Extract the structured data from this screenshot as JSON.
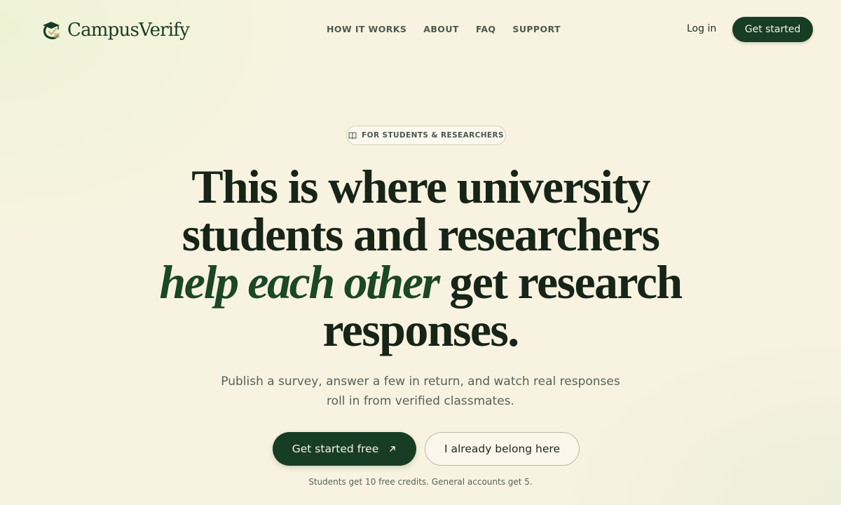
{
  "brand": {
    "name": "CampusVerify",
    "logo_icon": "graduation-cap-check-icon"
  },
  "nav": {
    "links": [
      "HOW IT WORKS",
      "ABOUT",
      "FAQ",
      "SUPPORT"
    ],
    "login": "Log in",
    "cta": "Get started"
  },
  "hero": {
    "badge": {
      "icon": "open-book-icon",
      "label": "FOR STUDENTS & RESEARCHERS"
    },
    "headline": {
      "line1": "This is where university",
      "line2": "students and researchers",
      "line3_italic": "help each other",
      "line3_rest": " get research",
      "line4": "responses."
    },
    "subtext_line1": "Publish a survey, answer a few in return, and watch real responses",
    "subtext_line2": "roll in from verified classmates.",
    "primary_button": "Get started free",
    "primary_icon": "arrow-up-right-icon",
    "secondary_button": "I already belong here",
    "fineprint": "Students get 10 free credits. General accounts get 5."
  },
  "colors": {
    "brand_green": "#173d24",
    "background": "#f8f3e1",
    "accent_gold": "#c9b57a"
  }
}
